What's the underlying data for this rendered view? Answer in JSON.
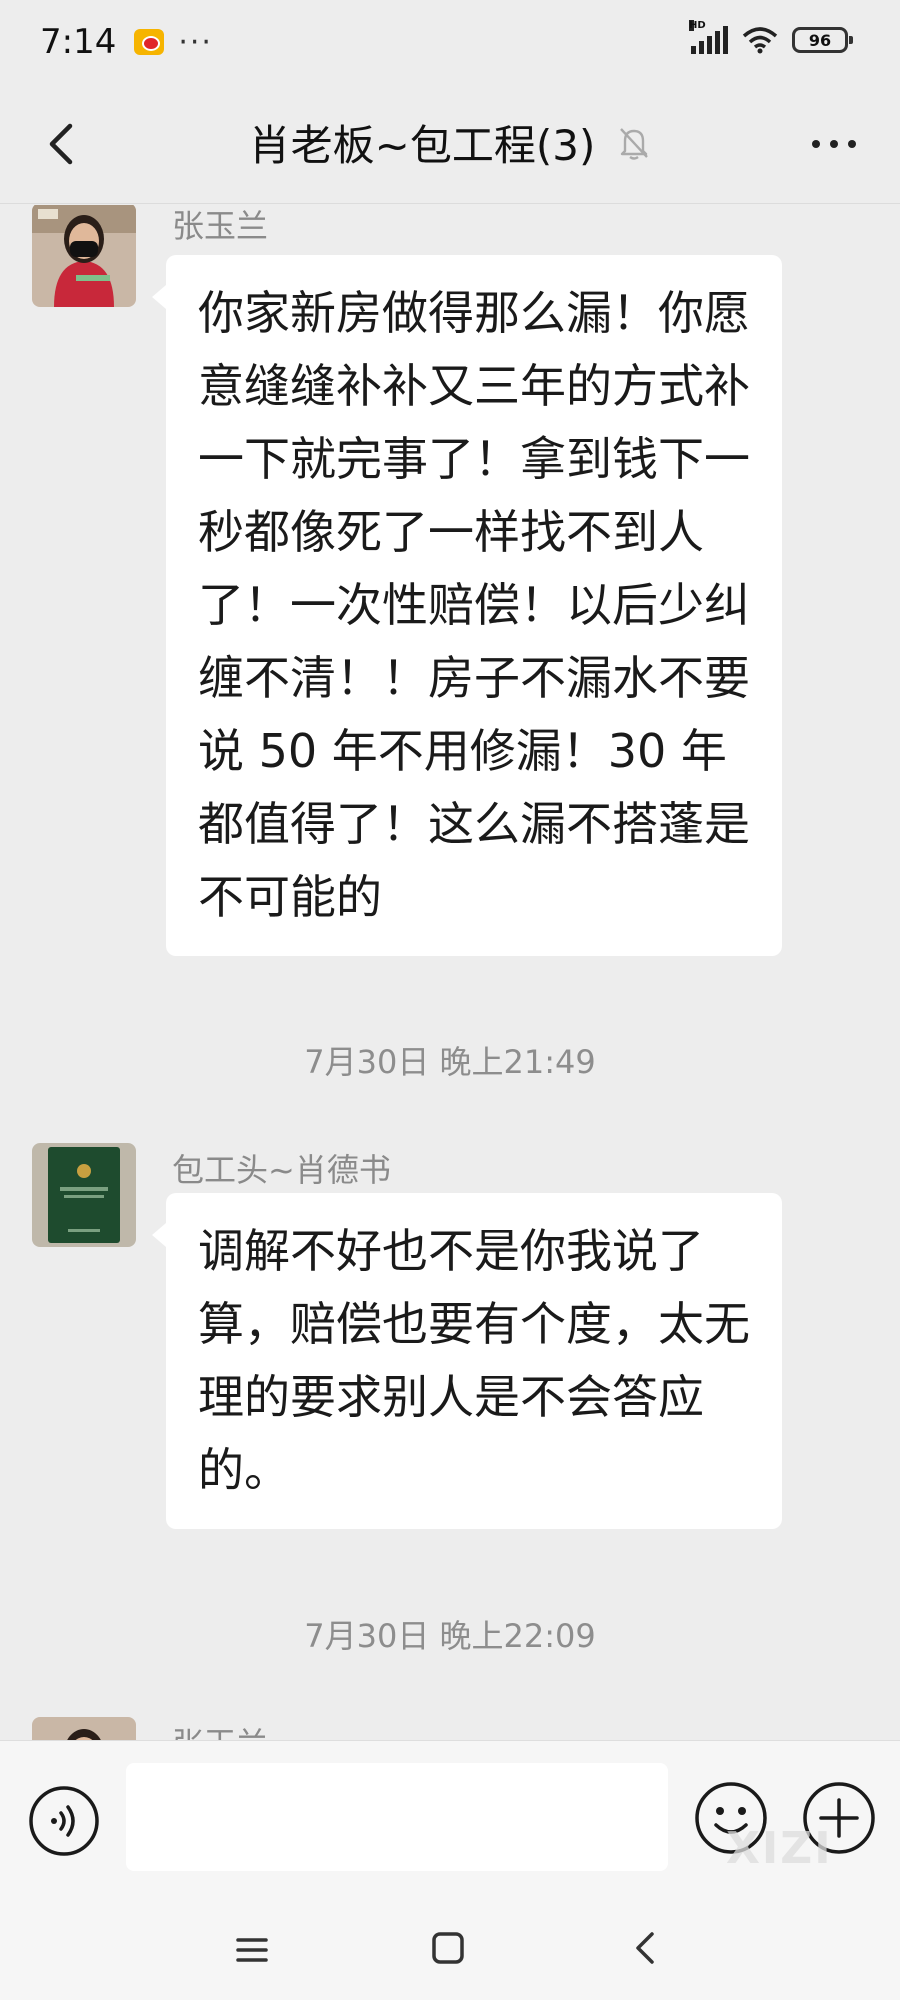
{
  "status_bar": {
    "time": "7:14",
    "dots": "···",
    "network_label": "HD",
    "battery": "96"
  },
  "header": {
    "title": "肖老板~包工程(3)",
    "back_icon": "chevron-left-icon",
    "mute_icon": "bell-off-icon",
    "more_icon": "more-dots-icon"
  },
  "messages": [
    {
      "sender": "张玉兰",
      "text": "你家新房做得那么漏！你愿意缝缝补补又三年的方式补一下就完事了！拿到钱下一秒都像死了一样找不到人了！一次性赔偿！以后少纠缠不清！！房子不漏水不要说 50 年不用修漏！30 年都值得了！这么漏不搭蓬是不可能的"
    },
    {
      "timestamp": "7月30日 晚上21:49"
    },
    {
      "sender": "包工头~肖德书",
      "text": "调解不好也不是你我说了算，赔偿也要有个度，太无理的要求别人是不会答应的。"
    },
    {
      "timestamp": "7月30日 晚上22:09"
    },
    {
      "sender": "张玉兰"
    }
  ],
  "input_bar": {
    "voice_icon": "voice-icon",
    "emoji_icon": "emoji-icon",
    "add_icon": "plus-circle-icon",
    "watermark": "XIZI"
  },
  "nav_bar": {
    "menu_icon": "menu-icon",
    "home_icon": "home-square-icon",
    "back_icon": "back-triangle-icon"
  },
  "colors": {
    "background": "#ededed",
    "bubble": "#ffffff",
    "meta_text": "#8a8a8a"
  }
}
